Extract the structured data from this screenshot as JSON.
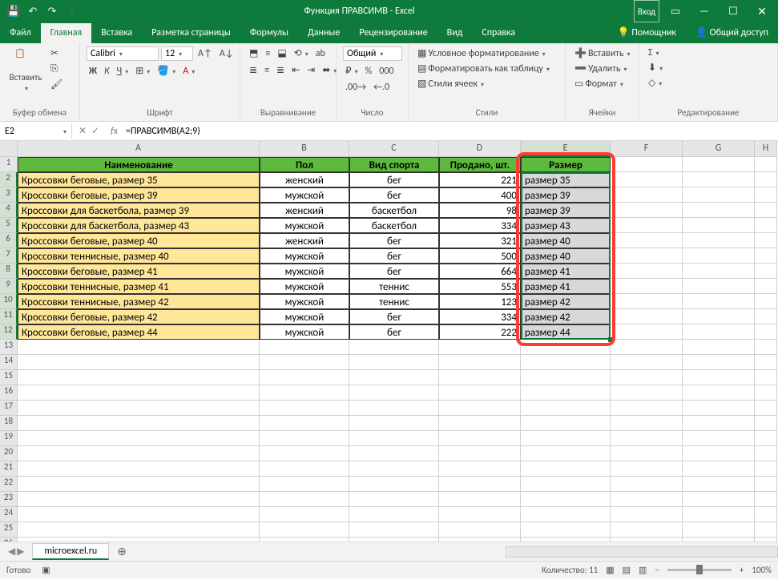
{
  "title": "Функция ПРАВСИМВ  -  Excel",
  "login": "Вход",
  "menu": {
    "file": "Файл",
    "home": "Главная",
    "insert": "Вставка",
    "layout": "Разметка страницы",
    "formulas": "Формулы",
    "data": "Данные",
    "review": "Рецензирование",
    "view": "Вид",
    "help": "Справка",
    "assistant": "Помощник",
    "share": "Общий доступ"
  },
  "ribbon": {
    "paste": "Вставить",
    "clipboard": "Буфер обмена",
    "font_name": "Calibri",
    "font_size": "12",
    "font_group": "Шрифт",
    "align_group": "Выравнивание",
    "number_format": "Общий",
    "number_group": "Число",
    "cond_format": "Условное форматирование",
    "as_table": "Форматировать как таблицу",
    "cell_styles": "Стили ячеек",
    "styles_group": "Стили",
    "insert_cells": "Вставить",
    "delete_cells": "Удалить",
    "format_cells": "Формат",
    "cells_group": "Ячейки",
    "editing_group": "Редактирование"
  },
  "name_box": "E2",
  "formula": "=ПРАВСИМВ(A2;9)",
  "columns": [
    "A",
    "B",
    "C",
    "D",
    "E",
    "F",
    "G",
    "H"
  ],
  "headers": {
    "A": "Наименование",
    "B": "Пол",
    "C": "Вид спорта",
    "D": "Продано, шт.",
    "E": "Размер"
  },
  "rows": [
    {
      "A": "Кроссовки беговые, размер 35",
      "B": "женский",
      "C": "бег",
      "D": "221",
      "E": "размер 35"
    },
    {
      "A": "Кроссовки беговые, размер 39",
      "B": "мужской",
      "C": "бег",
      "D": "400",
      "E": "размер 39"
    },
    {
      "A": "Кроссовки для баскетбола, размер 39",
      "B": "женский",
      "C": "баскетбол",
      "D": "98",
      "E": "размер 39"
    },
    {
      "A": "Кроссовки для баскетбола, размер 43",
      "B": "мужской",
      "C": "баскетбол",
      "D": "334",
      "E": "размер 43"
    },
    {
      "A": "Кроссовки беговые, размер 40",
      "B": "женский",
      "C": "бег",
      "D": "321",
      "E": "размер 40"
    },
    {
      "A": "Кроссовки теннисные, размер 40",
      "B": "мужской",
      "C": "бег",
      "D": "500",
      "E": "размер 40"
    },
    {
      "A": "Кроссовки беговые, размер 41",
      "B": "мужской",
      "C": "бег",
      "D": "664",
      "E": "размер 41"
    },
    {
      "A": "Кроссовки теннисные, размер 41",
      "B": "мужской",
      "C": "теннис",
      "D": "553",
      "E": "размер 41"
    },
    {
      "A": "Кроссовки теннисные, размер 42",
      "B": "мужской",
      "C": "теннис",
      "D": "123",
      "E": "размер 42"
    },
    {
      "A": "Кроссовки беговые, размер 42",
      "B": "мужской",
      "C": "бег",
      "D": "334",
      "E": "размер 42"
    },
    {
      "A": "Кроссовки беговые, размер 44",
      "B": "мужской",
      "C": "бег",
      "D": "222",
      "E": "размер 44"
    }
  ],
  "sheet_tab": "microexcel.ru",
  "status": {
    "ready": "Готово",
    "count_label": "Количество:",
    "count": "11",
    "zoom": "100%"
  }
}
